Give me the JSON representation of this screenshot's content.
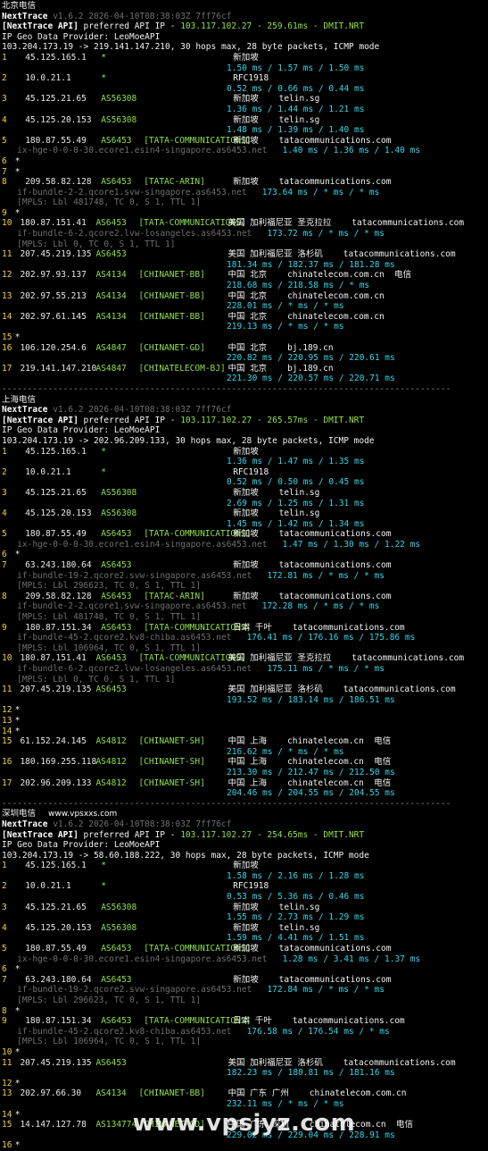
{
  "watermarks": {
    "inline": "www.vpsxxs.com",
    "bottom": "www.vpsjyz.com"
  },
  "sections": [
    {
      "title": "北京电信",
      "meta_line": "NextTrace v1.6.2 2026-04-10T08:38:03Z 7ff76cf",
      "api_prefix": "[NextTrace API]",
      "api_rest": " preferred API IP - ",
      "api_ip": "103.117.102.27",
      "api_ms": " - 259.61ms",
      "api_tail": " - DMIT.NRT",
      "geo": "IP Geo Data Provider: LeoMoeAPI",
      "trace": "103.204.173.19 -> 219.141.147.210, 30 hops max, 28 byte packets, ICMP mode",
      "hops": [
        {
          "n": "1",
          "ip": "45.125.165.1",
          "asn": "*",
          "tag": "",
          "loc": "新加坡",
          "host": "",
          "ms": "1.50 ms / 1.57 ms / 1.50 ms"
        },
        {
          "n": "2",
          "ip": "10.0.21.1",
          "asn": "*",
          "tag": "",
          "loc": "RFC1918",
          "host": "",
          "ms": "0.52 ms / 0.66 ms / 0.44 ms"
        },
        {
          "n": "3",
          "ip": "45.125.21.65",
          "asn": "AS56308",
          "tag": "",
          "loc": "新加坡",
          "host": "telin.sg",
          "ms": "1.36 ms / 1.44 ms / 1.21 ms"
        },
        {
          "n": "4",
          "ip": "45.125.20.153",
          "asn": "AS56308",
          "tag": "",
          "loc": "新加坡",
          "host": "telin.sg",
          "ms": "1.48 ms / 1.39 ms / 1.40 ms"
        },
        {
          "n": "5",
          "ip": "180.87.55.49",
          "asn": "AS6453",
          "tag": "[TATA-COMMUNICATIONS]",
          "loc": "新加坡",
          "host": "tatacommunications.com",
          "rdns": "ix-hge-0-0-0-30.ecore1.esin4-singapore.as6453.net",
          "ms_inline": "1.40 ms / 1.36 ms / 1.40 ms"
        },
        {
          "n": "6",
          "star": true
        },
        {
          "n": "7",
          "star": true
        },
        {
          "n": "8",
          "ip": "209.58.82.128",
          "asn": "AS6453",
          "tag": "[TATAC-ARIN]",
          "loc": "新加坡",
          "host": "tatacommunications.com",
          "rdns": "if-bundle-2-2.qcore1.svw-singapore.as6453.net",
          "ms_inline": "173.64 ms / * ms / * ms",
          "mpls": "[MPLS: Lbl 481748, TC 0, S 1, TTL 1]"
        },
        {
          "n": "9",
          "star": true
        },
        {
          "n": "10",
          "ip": "180.87.151.41",
          "asn": "AS6453",
          "tag": "[TATA-COMMUNICATIONS]",
          "loc": "美国 加利福尼亚 圣克拉拉",
          "host": "tatacommunications.com",
          "rdns": "if-bundle-6-2.qcore2.lvw-losangeles.as6453.net",
          "ms_inline": "173.72 ms / * ms / * ms",
          "mpls": "[MPLS: Lbl 0, TC 0, S 1, TTL 1]"
        },
        {
          "n": "11",
          "ip": "207.45.219.135",
          "asn": "AS6453",
          "tag": "",
          "loc": "美国 加利福尼亚 洛杉矶",
          "host": "tatacommunications.com",
          "ms": "181.34 ms / 182.37 ms / 181.28 ms"
        },
        {
          "n": "12",
          "ip": "202.97.93.137",
          "asn": "AS4134",
          "tag": "[CHINANET-BB]",
          "loc": "中国 北京",
          "host": "chinatelecom.com.cn  电信",
          "ms": "218.68 ms / 218.58 ms / * ms"
        },
        {
          "n": "13",
          "ip": "202.97.55.213",
          "asn": "AS4134",
          "tag": "[CHINANET-BB]",
          "loc": "中国 北京",
          "host": "chinatelecom.com.cn",
          "ms": "228.01 ms / * ms / * ms"
        },
        {
          "n": "14",
          "ip": "202.97.61.145",
          "asn": "AS4134",
          "tag": "[CHINANET-BB]",
          "loc": "中国 北京",
          "host": "chinatelecom.com.cn",
          "ms": "219.13 ms / * ms / * ms"
        },
        {
          "n": "15",
          "star": true
        },
        {
          "n": "16",
          "ip": "106.120.254.6",
          "asn": "AS4847",
          "tag": "[CHINANET-GD]",
          "loc": "中国 北京",
          "host": "bj.189.cn",
          "ms": "220.82 ms / 220.95 ms / 220.61 ms"
        },
        {
          "n": "17",
          "ip": "219.141.147.210",
          "asn": "AS4847",
          "tag": "[CHINATELECOM-BJ]",
          "loc": "中国 北京",
          "host": "bj.189.cn",
          "ms": "221.30 ms / 220.57 ms / 220.71 ms"
        }
      ]
    },
    {
      "title": "上海电信",
      "meta_line": "NextTrace v1.6.2 2026-04-10T08:38:03Z 7ff76cf",
      "api_prefix": "[NextTrace API]",
      "api_rest": " preferred API IP - ",
      "api_ip": "103.117.102.27",
      "api_ms": " - 265.57ms",
      "api_tail": " - DMIT.NRT",
      "geo": "IP Geo Data Provider: LeoMoeAPI",
      "trace": "103.204.173.19 -> 202.96.209.133, 30 hops max, 28 byte packets, ICMP mode",
      "hops": [
        {
          "n": "1",
          "ip": "45.125.165.1",
          "asn": "*",
          "tag": "",
          "loc": "新加坡",
          "host": "",
          "ms": "1.36 ms / 1.47 ms / 1.35 ms"
        },
        {
          "n": "2",
          "ip": "10.0.21.1",
          "asn": "*",
          "tag": "",
          "loc": "RFC1918",
          "host": "",
          "ms": "0.52 ms / 0.50 ms / 0.45 ms"
        },
        {
          "n": "3",
          "ip": "45.125.21.65",
          "asn": "AS56308",
          "tag": "",
          "loc": "新加坡",
          "host": "telin.sg",
          "ms": "2.69 ms / 1.25 ms / 1.31 ms"
        },
        {
          "n": "4",
          "ip": "45.125.20.153",
          "asn": "AS56308",
          "tag": "",
          "loc": "新加坡",
          "host": "telin.sg",
          "ms": "1.45 ms / 1.42 ms / 1.34 ms"
        },
        {
          "n": "5",
          "ip": "180.87.55.49",
          "asn": "AS6453",
          "tag": "[TATA-COMMUNICATIONS]",
          "loc": "新加坡",
          "host": "tatacommunications.com",
          "rdns": "ix-hge-0-0-0-30.ecore1.esin4-singapore.as6453.net",
          "ms_inline": "1.47 ms / 1.30 ms / 1.22 ms"
        },
        {
          "n": "6",
          "star": true
        },
        {
          "n": "7",
          "ip": "63.243.180.64",
          "asn": "AS6453",
          "tag": "",
          "loc": "新加坡",
          "host": "tatacommunications.com",
          "rdns": "if-bundle-19-2.qcore2.svw-singapore.as6453.net",
          "ms_inline": "172.81 ms / * ms / * ms",
          "mpls": "[MPLS: Lbl 296623, TC 0, S 1, TTL 1]"
        },
        {
          "n": "8",
          "ip": "209.58.82.128",
          "asn": "AS6453",
          "tag": "[TATAC-ARIN]",
          "loc": "新加坡",
          "host": "tatacommunications.com",
          "rdns": "if-bundle-2-2.qcore1.svw-singapore.as6453.net",
          "ms_inline": "172.28 ms / * ms / * ms",
          "mpls": "[MPLS: Lbl 481748, TC 0, S 1, TTL 1]"
        },
        {
          "n": "9",
          "ip": "180.87.151.34",
          "asn": "AS6453",
          "tag": "[TATA-COMMUNICATIONS]",
          "loc": "日本 千叶",
          "host": "tatacommunications.com",
          "rdns": "if-bundle-45-2.qcore2.kv8-chiba.as6453.net",
          "ms_inline": "176.41 ms / 176.16 ms / 175.86 ms",
          "mpls": "[MPLS: Lbl 106964, TC 0, S 1, TTL 1]"
        },
        {
          "n": "10",
          "ip": "180.87.151.41",
          "asn": "AS6453",
          "tag": "[TATA-COMMUNICATIONS]",
          "loc": "美国 加利福尼亚 圣克拉拉",
          "host": "tatacommunications.com",
          "rdns": "if-bundle-6-2.qcore2.lvw-losangeles.as6453.net",
          "ms_inline": "175.11 ms / * ms / * ms",
          "mpls": "[MPLS: Lbl 0, TC 0, S 1, TTL 1]"
        },
        {
          "n": "11",
          "ip": "207.45.219.135",
          "asn": "AS6453",
          "tag": "",
          "loc": "美国 加利福尼亚 洛杉矶",
          "host": "tatacommunications.com",
          "ms": "193.52 ms / 183.14 ms / 186.51 ms"
        },
        {
          "n": "12",
          "star": true
        },
        {
          "n": "13",
          "star": true
        },
        {
          "n": "14",
          "star": true
        },
        {
          "n": "15",
          "ip": "61.152.24.145",
          "asn": "AS4812",
          "tag": "[CHINANET-SH]",
          "loc": "中国 上海",
          "host": "chinatelecom.cn  电信",
          "ms": "216.62 ms / * ms / * ms"
        },
        {
          "n": "16",
          "ip": "180.169.255.118",
          "asn": "AS4812",
          "tag": "[CHINANET-SH]",
          "loc": "中国 上海",
          "host": "chinatelecom.cn  电信",
          "ms": "213.30 ms / 212.47 ms / 212.50 ms"
        },
        {
          "n": "17",
          "ip": "202.96.209.133",
          "asn": "AS4812",
          "tag": "[CHINANET-SH]",
          "loc": "中国 上海",
          "host": "chinatelecom.cn  电信",
          "ms": "204.46 ms / 204.55 ms / 204.55 ms"
        }
      ]
    },
    {
      "title": "深圳电信",
      "meta_line": "NextTrace v1.6.2 2026-04-10T08:38:03Z 7ff76cf",
      "api_prefix": "[NextTrace API]",
      "api_rest": " preferred API IP - ",
      "api_ip": "103.117.102.27",
      "api_ms": " - 254.65ms",
      "api_tail": " - DMIT.NRT",
      "geo": "IP Geo Data Provider: LeoMoeAPI",
      "trace": "103.204.173.19 -> 58.60.188.222, 30 hops max, 28 byte packets, ICMP mode",
      "hops": [
        {
          "n": "1",
          "ip": "45.125.165.1",
          "asn": "*",
          "tag": "",
          "loc": "新加坡",
          "host": "",
          "ms": "1.58 ms / 2.16 ms / 1.28 ms"
        },
        {
          "n": "2",
          "ip": "10.0.21.1",
          "asn": "*",
          "tag": "",
          "loc": "RFC1918",
          "host": "",
          "ms": "0.53 ms / 5.36 ms / 0.46 ms"
        },
        {
          "n": "3",
          "ip": "45.125.21.65",
          "asn": "AS56308",
          "tag": "",
          "loc": "新加坡",
          "host": "telin.sg",
          "ms": "1.55 ms / 2.73 ms / 1.29 ms"
        },
        {
          "n": "4",
          "ip": "45.125.20.153",
          "asn": "AS56308",
          "tag": "",
          "loc": "新加坡",
          "host": "telin.sg",
          "ms": "1.59 ms / 4.41 ms / 1.51 ms"
        },
        {
          "n": "5",
          "ip": "180.87.55.49",
          "asn": "AS6453",
          "tag": "[TATA-COMMUNICATIONS]",
          "loc": "新加坡",
          "host": "tatacommunications.com",
          "rdns": "ix-hge-0-0-0-30.ecore1.esin4-singapore.as6453.net",
          "ms_inline": "1.28 ms / 3.41 ms / 1.37 ms"
        },
        {
          "n": "6",
          "star": true
        },
        {
          "n": "7",
          "ip": "63.243.180.64",
          "asn": "AS6453",
          "tag": "",
          "loc": "新加坡",
          "host": "tatacommunications.com",
          "rdns": "if-bundle-19-2.qcore2.svw-singapore.as6453.net",
          "ms_inline": "172.84 ms / * ms / * ms",
          "mpls": "[MPLS: Lbl 296623, TC 0, S 1, TTL 1]"
        },
        {
          "n": "8",
          "star": true
        },
        {
          "n": "9",
          "ip": "180.87.151.34",
          "asn": "AS6453",
          "tag": "[TATA-COMMUNICATIONS]",
          "loc": "日本 千叶",
          "host": "tatacommunications.com",
          "rdns": "if-bundle-45-2.qcore2.kv8-chiba.as6453.net",
          "ms_inline": "176.58 ms / 176.54 ms / * ms",
          "mpls": "[MPLS: Lbl 106964, TC 0, S 1, TTL 1]"
        },
        {
          "n": "10",
          "star": true
        },
        {
          "n": "11",
          "ip": "207.45.219.135",
          "asn": "AS6453",
          "tag": "",
          "loc": "美国 加利福尼亚 洛杉矶",
          "host": "tatacommunications.com",
          "ms": "182.23 ms / 180.81 ms / 181.16 ms"
        },
        {
          "n": "12",
          "star": true
        },
        {
          "n": "13",
          "ip": "202.97.66.30",
          "asn": "AS4134",
          "tag": "[CHINANET-BB]",
          "loc": "中国 广东 广州",
          "host": "chinatelecom.com.cn",
          "ms": "232.11 ms / * ms / * ms"
        },
        {
          "n": "14",
          "star": true
        },
        {
          "n": "15",
          "ip": "14.147.127.78",
          "asn": "AS134774",
          "tag": "[CHINANET-GD]",
          "loc": "中国 广东 深圳",
          "host": "chinatelecom.cn  电信",
          "ms": "229.02 ms / 229.04 ms / 228.91 ms"
        },
        {
          "n": "16",
          "star": true
        }
      ]
    }
  ],
  "separator": "----------------------------------------------------------------------------------------",
  "colors": {
    "background": "#000000",
    "yellow": "#f0d23c",
    "green": "#8fe04a",
    "cyan": "#33d6e8",
    "gray": "#6f6f6f"
  }
}
